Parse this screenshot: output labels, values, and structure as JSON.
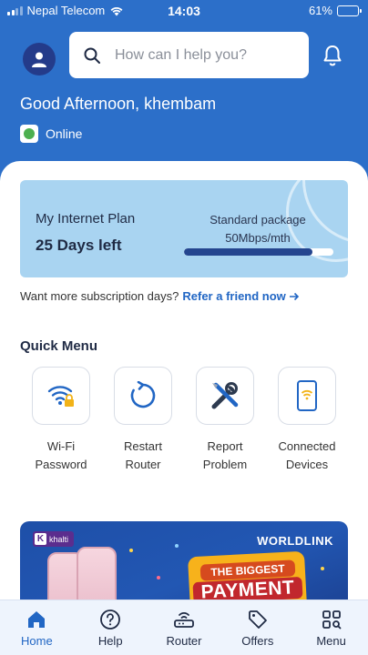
{
  "status_bar": {
    "carrier": "Nepal Telecom",
    "time": "14:03",
    "battery": "61%",
    "battery_level": 0.61
  },
  "header": {
    "search_placeholder": "How can I help you?",
    "greeting": "Good Afternoon, khembam",
    "connection_status": "Online"
  },
  "plan": {
    "title": "My Internet Plan",
    "days_left": "25 Days left",
    "package_name": "Standard package",
    "package_speed": "50Mbps/mth",
    "progress": 0.86
  },
  "referral": {
    "text": "Want more subscription days?",
    "link": "Refer a friend now"
  },
  "quick_menu": {
    "title": "Quick Menu",
    "items": [
      {
        "label": "Wi-Fi\nPassword",
        "icon": "wifi-lock-icon"
      },
      {
        "label": "Restart\nRouter",
        "icon": "restart-icon"
      },
      {
        "label": "Report\nProblem",
        "icon": "tools-icon"
      },
      {
        "label": "Connected\nDevices",
        "icon": "phone-wifi-icon"
      }
    ]
  },
  "banner": {
    "partner": "khalti",
    "brand": "WORLDLINK",
    "headline_top": "THE BIGGEST",
    "headline_main": "PAYMENT"
  },
  "nav": {
    "items": [
      {
        "label": "Home",
        "icon": "home-icon",
        "active": true
      },
      {
        "label": "Help",
        "icon": "help-icon",
        "active": false
      },
      {
        "label": "Router",
        "icon": "router-icon",
        "active": false
      },
      {
        "label": "Offers",
        "icon": "offer-tag-icon",
        "active": false
      },
      {
        "label": "Menu",
        "icon": "grid-menu-icon",
        "active": false
      }
    ]
  },
  "colors": {
    "header_bg": "#2c6fc9",
    "plan_bg": "#a9d4f1",
    "accent": "#2166c4",
    "progress": "#24458f"
  }
}
